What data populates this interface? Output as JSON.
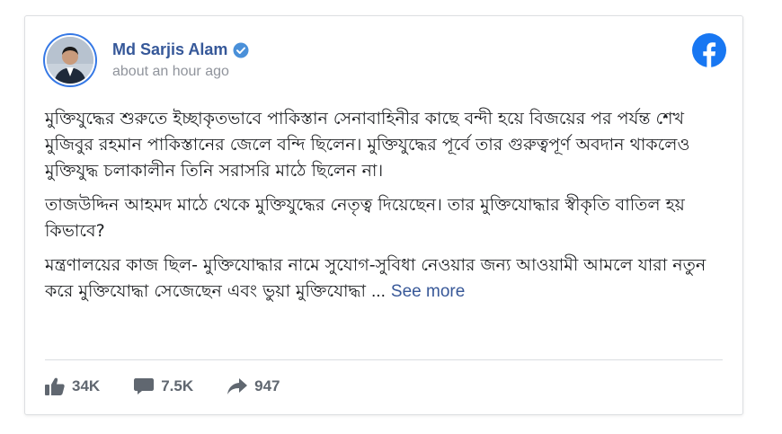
{
  "post": {
    "author": "Md Sarjis Alam",
    "timestamp": "about an hour ago",
    "paragraphs": [
      "মুক্তিযুদ্ধের শুরুতে ইচ্ছাকৃতভাবে পাকিস্তান সেনাবাহিনীর কাছে বন্দী হয়ে বিজয়ের পর পর্যন্ত শেখ মুজিবুর রহমান পাকিস্তানের জেলে বন্দি ছিলেন। মুক্তিযুদ্ধের পূর্বে তার গুরুত্বপূর্ণ অবদান থাকলেও মুক্তিযুদ্ধ চলাকালীন তিনি সরাসরি মাঠে ছিলেন না।",
      "তাজউদ্দিন আহমদ মাঠে থেকে মুক্তিযুদ্ধের নেতৃত্ব দিয়েছেন। তার মুক্তিযোদ্ধার স্বীকৃতি বাতিল হয় কিভাবে?",
      "মন্ত্রণালয়ের কাজ ছিল- মুক্তিযোদ্ধার নামে সুযোগ-সুবিধা নেওয়ার জন্য আওয়ামী আমলে যারা নতুন করে মুক্তিযোদ্ধা সেজেছেন এবং ভুয়া মুক্তিযোদ্ধা"
    ],
    "ellipsis": "...",
    "see_more": "See more",
    "likes": "34K",
    "comments": "7.5K",
    "shares": "947"
  },
  "icons": {
    "verified": "verified-badge-icon",
    "facebook": "facebook-logo-icon",
    "like": "thumbs-up-icon",
    "comment": "comment-bubble-icon",
    "share": "share-arrow-icon"
  },
  "colors": {
    "author_link": "#365899",
    "facebook_blue": "#1877f2",
    "see_more": "#385898",
    "meta_gray": "#90949c",
    "stat_gray": "#606770"
  }
}
